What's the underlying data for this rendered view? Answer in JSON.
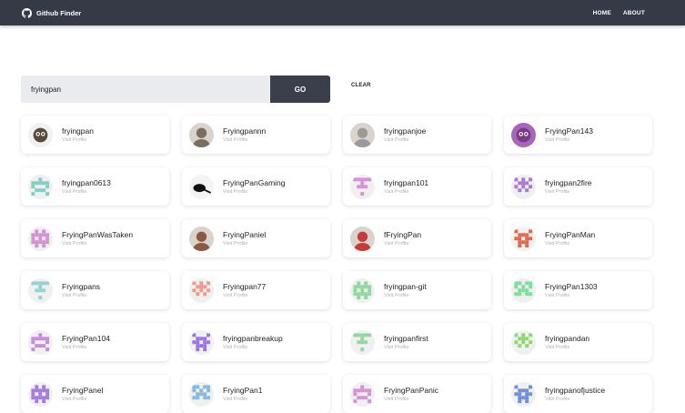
{
  "nav": {
    "brand": "Github Finder",
    "links": [
      "HOME",
      "ABOUT"
    ]
  },
  "search": {
    "value": "fryingpan",
    "button_label": "GO",
    "clear_label": "CLEAR"
  },
  "visit_label": "Visit Profile",
  "users": [
    {
      "login": "fryingpan",
      "avatar": "cartoon",
      "color": "#f1f1f1"
    },
    {
      "login": "Fryingpannn",
      "avatar": "photo",
      "color": "#7a6f5e"
    },
    {
      "login": "fryingpanjoe",
      "avatar": "photo",
      "color": "#9a9a9a"
    },
    {
      "login": "FryingPan143",
      "avatar": "cartoon",
      "color": "#a866b8"
    },
    {
      "login": "fryingpan0613",
      "avatar": "identicon",
      "color": "#7fcfc3"
    },
    {
      "login": "FryingPanGaming",
      "avatar": "pan-silhouette",
      "color": "#111111"
    },
    {
      "login": "fryingpan101",
      "avatar": "identicon",
      "color": "#d78fd6"
    },
    {
      "login": "fryingpan2fire",
      "avatar": "identicon",
      "color": "#a77ad6"
    },
    {
      "login": "FryingPanWasTaken",
      "avatar": "identicon",
      "color": "#d78fd6"
    },
    {
      "login": "FryingPaniel",
      "avatar": "photo",
      "color": "#8a5a40"
    },
    {
      "login": "fFryingPan",
      "avatar": "photo",
      "color": "#c93a3a"
    },
    {
      "login": "FryingPanMan",
      "avatar": "identicon",
      "color": "#dd6a4e"
    },
    {
      "login": "Fryingpans",
      "avatar": "identicon",
      "color": "#8fd3d8"
    },
    {
      "login": "Fryingpan77",
      "avatar": "identicon",
      "color": "#ef9a8a"
    },
    {
      "login": "fryingpan-git",
      "avatar": "identicon",
      "color": "#8fd8a0"
    },
    {
      "login": "FryingPan1303",
      "avatar": "identicon",
      "color": "#7fdc9e"
    },
    {
      "login": "FryingPan104",
      "avatar": "identicon",
      "color": "#c98ad8"
    },
    {
      "login": "fryingpanbreakup",
      "avatar": "identicon",
      "color": "#9a74e6"
    },
    {
      "login": "fryingpanfirst",
      "avatar": "identicon",
      "color": "#8fd8a0"
    },
    {
      "login": "fryingpandan",
      "avatar": "identicon",
      "color": "#8ed872"
    },
    {
      "login": "FryingPanel",
      "avatar": "identicon",
      "color": "#a57ad8"
    },
    {
      "login": "FryingPan1",
      "avatar": "identicon",
      "color": "#8ab8e0"
    },
    {
      "login": "FryingPanPanic",
      "avatar": "identicon",
      "color": "#d78fd6"
    },
    {
      "login": "fryingpanofjustice",
      "avatar": "identicon",
      "color": "#6f8fd8"
    }
  ]
}
